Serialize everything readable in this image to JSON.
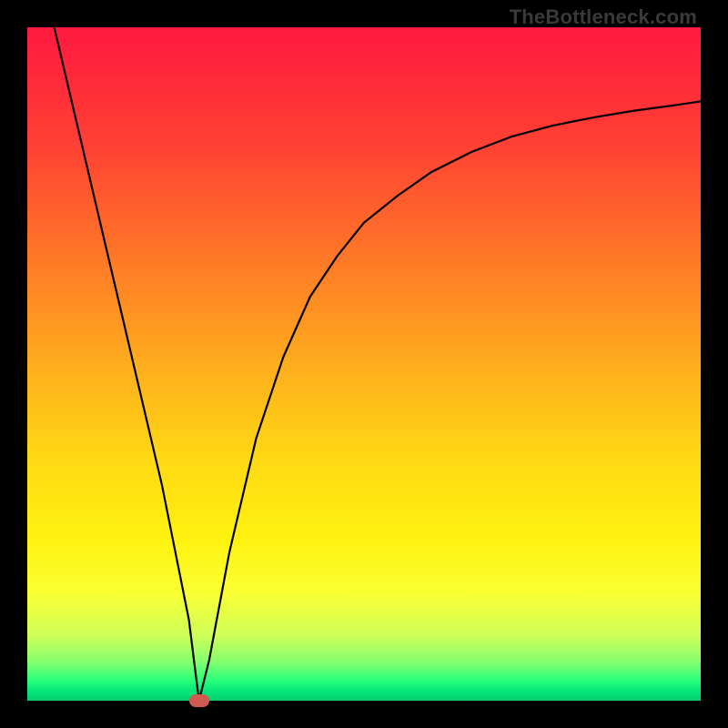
{
  "watermark": "TheBottleneck.com",
  "chart_data": {
    "type": "line",
    "title": "",
    "xlabel": "",
    "ylabel": "",
    "xlim": [
      0,
      100
    ],
    "ylim": [
      0,
      100
    ],
    "grid": false,
    "legend": false,
    "series": [
      {
        "name": "curve",
        "x": [
          4,
          8,
          12,
          16,
          20,
          24,
          25.5,
          27,
          30,
          34,
          38,
          42,
          46,
          50,
          55,
          60,
          66,
          72,
          78,
          84,
          90,
          96,
          100
        ],
        "y": [
          100,
          83,
          66,
          49,
          32,
          12,
          0,
          6,
          22,
          39,
          51,
          60,
          66,
          71,
          75,
          78.5,
          81.5,
          83.8,
          85.4,
          86.6,
          87.6,
          88.4,
          89
        ]
      }
    ],
    "marker": {
      "x": 25.5,
      "y": 0,
      "color": "#cf5a52"
    },
    "background_gradient": [
      "#ff1a3f",
      "#ff4233",
      "#ff8b24",
      "#ffd814",
      "#f9ff33",
      "#2aff7b",
      "#04cf6e"
    ]
  }
}
